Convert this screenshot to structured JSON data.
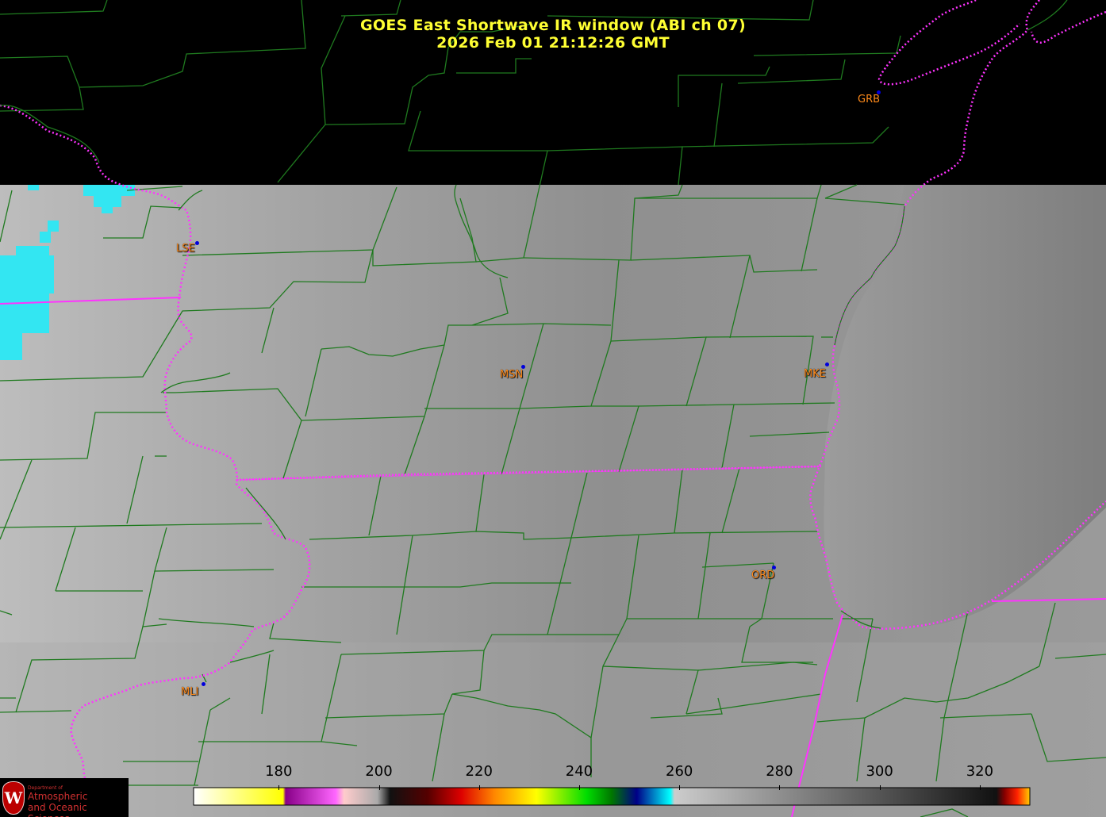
{
  "title": {
    "line1": "GOES East Shortwave IR window (ABI ch 07)",
    "line2": "2026 Feb 01  21:12:26 GMT"
  },
  "stations": [
    {
      "id": "LSE",
      "label": "LSE"
    },
    {
      "id": "MSN",
      "label": "MSN"
    },
    {
      "id": "MKE",
      "label": "MKE"
    },
    {
      "id": "GRB",
      "label": "GRB"
    },
    {
      "id": "ORD",
      "label": "ORD"
    },
    {
      "id": "MLI",
      "label": "MLI"
    }
  ],
  "colorbar": {
    "min": 163,
    "max": 330,
    "ticks": [
      "180",
      "200",
      "220",
      "240",
      "260",
      "280",
      "300",
      "320"
    ],
    "tick_values": [
      180,
      200,
      220,
      240,
      260,
      280,
      300,
      320
    ]
  },
  "logo": {
    "crest": "W",
    "dept": "Department of",
    "line1": "Atmospheric",
    "line2": "and Oceanic Sciences"
  },
  "colors": {
    "county_lines": "#1f7a1f",
    "state_lines": "#ff33ff",
    "station_labels": "#ff8a1a",
    "station_dots": "#0000dd",
    "title_text": "#ffff33",
    "cold_cloud": "#33e6f2"
  }
}
